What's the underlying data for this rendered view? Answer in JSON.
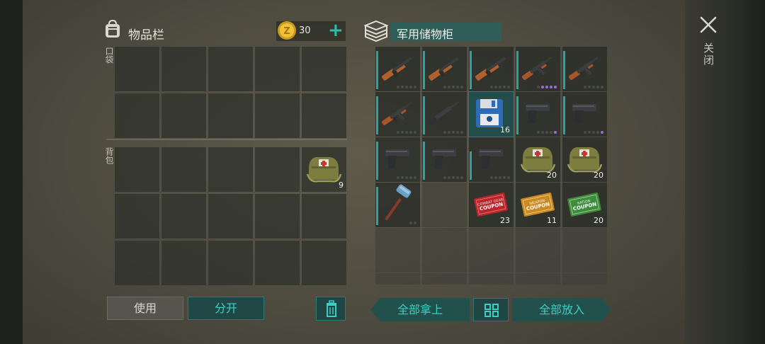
{
  "inventory": {
    "title": "物品栏",
    "coins": "30",
    "pocket_label": "口袋",
    "backpack_label": "背包",
    "backpack_item": {
      "icon": "first-aid-kit-icon",
      "qty": "9"
    }
  },
  "storage": {
    "title": "军用储物柜",
    "slots": [
      {
        "icon": "shotgun-icon",
        "qty": "",
        "durability": 0
      },
      {
        "icon": "shotgun-icon",
        "qty": "",
        "durability": 0
      },
      {
        "icon": "shotgun-icon",
        "qty": "",
        "durability": 0
      },
      {
        "icon": "assault-rifle-icon",
        "qty": "",
        "durability": 4
      },
      {
        "icon": "assault-rifle-icon",
        "qty": "",
        "durability": 0
      },
      {
        "icon": "assault-rifle-icon",
        "qty": "",
        "durability": 0
      },
      {
        "icon": "rifle-icon",
        "qty": "",
        "durability": 0
      },
      {
        "icon": "floppy-disk-icon",
        "qty": "16",
        "durability": 0
      },
      {
        "icon": "pistol-icon",
        "qty": "",
        "durability": 1
      },
      {
        "icon": "pistol-icon",
        "qty": "",
        "durability": 1
      },
      {
        "icon": "pistol-icon",
        "qty": "",
        "durability": 0
      },
      {
        "icon": "pistol-icon",
        "qty": "",
        "durability": 0
      },
      {
        "icon": "pistol-icon",
        "qty": "",
        "durability": 0
      },
      {
        "icon": "first-aid-kit-icon",
        "qty": "20",
        "durability": 0
      },
      {
        "icon": "first-aid-kit-icon",
        "qty": "20",
        "durability": 0
      },
      {
        "icon": "hammer-icon",
        "qty": "",
        "durability": 0
      },
      {
        "icon": "",
        "qty": "",
        "durability": 0
      },
      {
        "icon": "coupon-red-icon",
        "qty": "23",
        "durability": 0
      },
      {
        "icon": "coupon-orange-icon",
        "qty": "11",
        "durability": 0
      },
      {
        "icon": "coupon-green-icon",
        "qty": "20",
        "durability": 0
      }
    ]
  },
  "buttons": {
    "use": "使用",
    "split": "分开",
    "take_all": "全部拿上",
    "put_all": "全部放入",
    "close": "关闭"
  },
  "colors": {
    "accent": "#2ebdb3",
    "rarity_purple": "#9d6bd8"
  }
}
